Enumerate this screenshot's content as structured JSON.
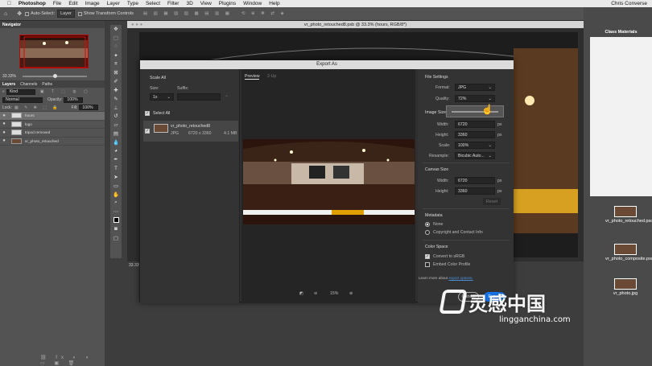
{
  "menubar": {
    "app": "Photoshop",
    "items": [
      "File",
      "Edit",
      "Image",
      "Layer",
      "Type",
      "Select",
      "Filter",
      "3D",
      "View",
      "Plugins",
      "Window",
      "Help"
    ],
    "user": "Chris Converse"
  },
  "optbar": {
    "auto_select": "Auto-Select:",
    "layer_dropdown": "Layer",
    "transform_controls": "Show Transform Controls"
  },
  "navigator": {
    "tab": "Navigator",
    "zoom": "33.33%"
  },
  "layers": {
    "tabs": [
      "Layers",
      "Channels",
      "Paths"
    ],
    "filter": "Kind",
    "blend": "Normal",
    "opacity_label": "Opacity:",
    "opacity": "100%",
    "lock_label": "Lock:",
    "fill_label": "Fill:",
    "fill": "100%",
    "rows": [
      {
        "name": "hours"
      },
      {
        "name": "logo"
      },
      {
        "name": "tripod removed"
      },
      {
        "name": "vr_photo_retouched"
      }
    ]
  },
  "document": {
    "tab_title": "vr_photo_retouched8.psb @ 33.3% (hours, RGB/8*)",
    "zoom": "33.33%"
  },
  "desktop": {
    "class_materials": "Class Materials",
    "files": [
      "vr_photo_retouched.psd",
      "vr_photo_composite.psd",
      "vr_photo.jpg"
    ]
  },
  "dialog": {
    "title": "Export As",
    "scale_all": "Scale All",
    "size_label": "Size:",
    "suffix_label": "Suffix:",
    "size_value": "1x",
    "select_all": "Select All",
    "asset": {
      "name": "vr_photo_retouched8",
      "format": "JPG",
      "dims": "6720 x 3360",
      "filesize": "4.1 MB"
    },
    "preview_tabs": [
      "Preview",
      "2-Up"
    ],
    "zoom": "15%",
    "file_settings": "File Settings",
    "format_label": "Format:",
    "format": "JPG",
    "quality_label": "Quality:",
    "quality": "72%",
    "image_size": "Image Size",
    "width_label": "Width:",
    "height_label": "Height:",
    "width": "6720",
    "height": "3360",
    "px": "px",
    "scale_label": "Scale:",
    "scale": "100%",
    "resample_label": "Resample:",
    "resample": "Bicubic Auto...",
    "canvas_size": "Canvas Size",
    "canvas_width": "6720",
    "canvas_height": "3360",
    "reset": "Reset",
    "metadata": "Metadata",
    "meta_none": "None",
    "meta_copyright": "Copyright and Contact Info",
    "color_space": "Color Space",
    "convert_srgb": "Convert to sRGB",
    "embed_profile": "Embed Color Profile",
    "learn_more": "Learn more about",
    "export_options": "export options.",
    "cancel": "Cancel",
    "export": "Export"
  },
  "watermark": {
    "cn": "灵感中国",
    "url": "lingganchina.com"
  }
}
